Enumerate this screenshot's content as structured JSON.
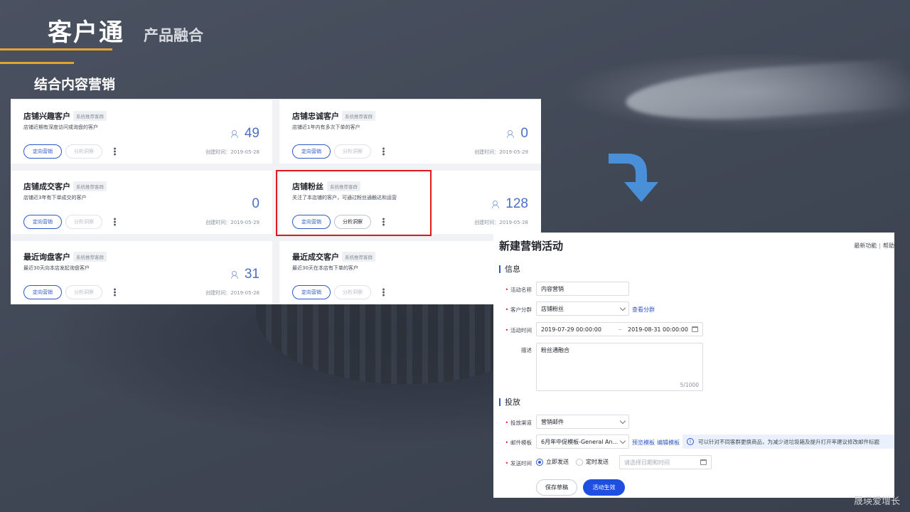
{
  "slide": {
    "title": "客户通",
    "subtitle": "产品融合",
    "section": "结合内容营销",
    "watermark": "晟瑛爱增长"
  },
  "segments": {
    "cards": [
      {
        "name": "店铺兴趣客户",
        "tag": "系统推荐客群",
        "desc": "店铺近期有深度访问或询盘的客户",
        "count": "49",
        "target_btn": "定向营销",
        "analyze_btn": "分析洞察",
        "analyze_enabled": false,
        "created": "创建时间：2019-05-28"
      },
      {
        "name": "店铺忠诚客户",
        "tag": "系统推荐客群",
        "desc": "店铺近1年内有多次下单的客户",
        "count": "0",
        "target_btn": "定向营销",
        "analyze_btn": "分析洞察",
        "analyze_enabled": false,
        "created": "创建时间：2019-05-29"
      },
      {
        "name": "店铺成交客户",
        "tag": "系统推荐客群",
        "desc": "店铺近3年有下单成交的客户",
        "count": "0",
        "target_btn": "定向营销",
        "analyze_btn": "分析洞察",
        "analyze_enabled": false,
        "created": "创建时间：2019-05-29"
      },
      {
        "name": "店铺粉丝",
        "tag": "系统推荐客群",
        "desc": "关注了本店铺的客户，可通过粉丝通触达和运营",
        "count": "128",
        "target_btn": "定向营销",
        "analyze_btn": "分析洞察",
        "analyze_enabled": true,
        "created": "创建时间：2019-05-28"
      },
      {
        "name": "最近询盘客户",
        "tag": "系统推荐客群",
        "desc": "最近30天向本店发起询盘客户",
        "count": "31",
        "target_btn": "定向营销",
        "analyze_btn": "分析洞察",
        "analyze_enabled": false,
        "created": "创建时间：2019-05-28"
      },
      {
        "name": "最近成交客户",
        "tag": "系统推荐客群",
        "desc": "最近30天在本店有下单的客户",
        "count": "",
        "target_btn": "定向营销",
        "analyze_btn": "分析洞察",
        "analyze_enabled": false,
        "created": ""
      }
    ]
  },
  "form": {
    "title": "新建营销活动",
    "links": {
      "whats_new": "最新功能",
      "help": "帮助文"
    },
    "info_group": "信息",
    "delivery_group": "投放",
    "fields": {
      "name_label": "活动名称",
      "name_value": "内容营销",
      "segment_label": "客户分群",
      "segment_value": "店铺粉丝",
      "segment_link": "查看分群",
      "time_label": "活动时间",
      "time_start": "2019-07-29 00:00:00",
      "time_sep": "~",
      "time_end": "2019-08-31 00:00:00",
      "desc_label": "描述",
      "desc_value": "粉丝通融合",
      "desc_counter": "5/1000",
      "channel_label": "投放渠道",
      "channel_value": "营销邮件",
      "template_label": "邮件模板",
      "template_value": "6月年中促模板-General An...",
      "preview_link": "预览模板",
      "edit_link": "编辑模板",
      "tip": "可以针对不同客群更换商品，为减少进垃圾箱及提升打开率建议修改邮件标题",
      "send_label": "发送时间",
      "send_now": "立即发送",
      "send_scheduled": "定时发送",
      "date_placeholder": "请选择日期和时间"
    },
    "buttons": {
      "draft": "保存草稿",
      "activate": "活动生效"
    }
  },
  "colors": {
    "accent": "#2f59c9",
    "highlight": "#e0191d",
    "gold": "#e3a32e",
    "arrow": "#4a90d9"
  }
}
